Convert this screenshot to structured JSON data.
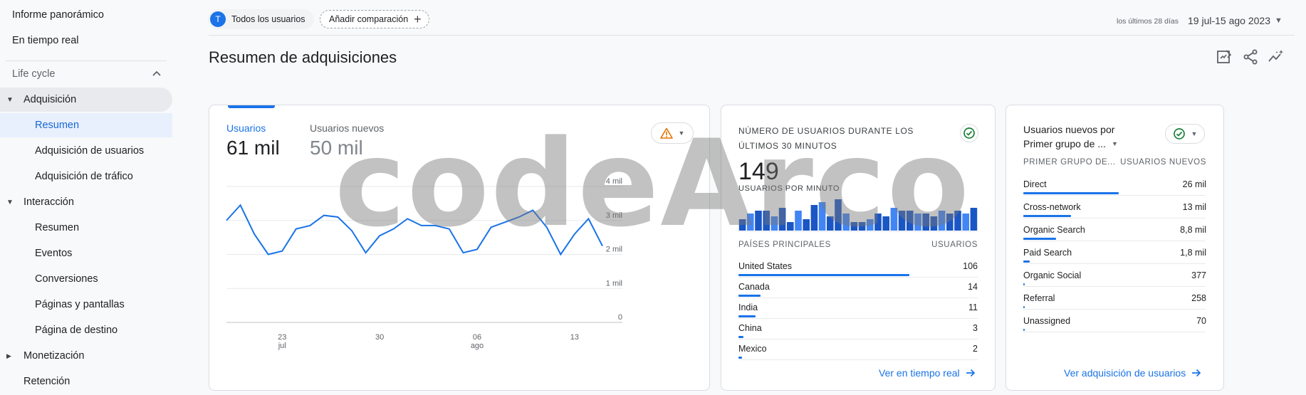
{
  "sidebar": {
    "top_items": [
      {
        "label": "Informe panorámico"
      },
      {
        "label": "En tiempo real"
      }
    ],
    "section": {
      "label": "Life cycle"
    },
    "groups": {
      "adquisicion": {
        "label": "Adquisición",
        "items": [
          "Resumen",
          "Adquisición de usuarios",
          "Adquisición de tráfico"
        ]
      },
      "interaccion": {
        "label": "Interacción",
        "items": [
          "Resumen",
          "Eventos",
          "Conversiones",
          "Páginas y pantallas",
          "Página de destino"
        ]
      },
      "monetizacion": {
        "label": "Monetización"
      },
      "retencion": {
        "label": "Retención"
      }
    }
  },
  "topbar": {
    "avatar_letter": "T",
    "segment_label": "Todos los usuarios",
    "add_comparison": "Añadir comparación",
    "date_hint": "los últimos 28 días",
    "date_range": "19 jul-15 ago 2023"
  },
  "page": {
    "title": "Resumen de adquisiciones"
  },
  "users_card": {
    "metric1_label": "Usuarios",
    "metric1_value": "61 mil",
    "metric2_label": "Usuarios nuevos",
    "metric2_value": "50 mil"
  },
  "chart_data": {
    "type": "line",
    "x": [
      "19 jul",
      "20 jul",
      "21 jul",
      "22 jul",
      "23 jul",
      "24 jul",
      "25 jul",
      "26 jul",
      "27 jul",
      "28 jul",
      "29 jul",
      "30 jul",
      "31 jul",
      "01 ago",
      "02 ago",
      "03 ago",
      "04 ago",
      "05 ago",
      "06 ago",
      "07 ago",
      "08 ago",
      "09 ago",
      "10 ago",
      "11 ago",
      "12 ago",
      "13 ago",
      "14 ago",
      "15 ago"
    ],
    "series": [
      {
        "values": [
          3.0,
          3.45,
          2.6,
          2.0,
          2.1,
          2.75,
          2.85,
          3.15,
          3.1,
          2.7,
          2.05,
          2.55,
          2.75,
          3.05,
          2.85,
          2.85,
          2.75,
          2.05,
          2.15,
          2.8,
          2.95,
          3.1,
          3.3,
          2.8,
          2.0,
          2.6,
          3.05,
          2.25
        ]
      }
    ],
    "x_ticks": [
      {
        "at": "23 jul",
        "day": "23",
        "month": "jul"
      },
      {
        "at": "30 jul",
        "day": "30",
        "month": ""
      },
      {
        "at": "06 ago",
        "day": "06",
        "month": "ago"
      },
      {
        "at": "13 ago",
        "day": "13",
        "month": ""
      }
    ],
    "y_ticks": [
      {
        "value": 4,
        "label": "4 mil"
      },
      {
        "value": 3,
        "label": "3 mil"
      },
      {
        "value": 2,
        "label": "2 mil"
      },
      {
        "value": 1,
        "label": "1 mil"
      },
      {
        "value": 0,
        "label": "0"
      }
    ],
    "ylim": [
      0,
      4
    ],
    "grid": true,
    "line_color": "#1a73e8"
  },
  "realtime_card": {
    "title": "NÚMERO DE USUARIOS DURANTE LOS ÚLTIMOS 30 MINUTOS",
    "value": "149",
    "subtitle": "USUARIOS POR MINUTO",
    "minute_bars": [
      4,
      6,
      7,
      7,
      5,
      8,
      3,
      7,
      4,
      9,
      10,
      5,
      11,
      6,
      3,
      3,
      4,
      6,
      5,
      8,
      7,
      7,
      6,
      6,
      5,
      7,
      6,
      7,
      6,
      8
    ],
    "col_country": "PAÍSES PRINCIPALES",
    "col_users": "USUARIOS",
    "rows": [
      {
        "name": "United States",
        "value": "106",
        "share": 1.0
      },
      {
        "name": "Canada",
        "value": "14",
        "share": 0.13
      },
      {
        "name": "India",
        "value": "11",
        "share": 0.1
      },
      {
        "name": "China",
        "value": "3",
        "share": 0.03
      },
      {
        "name": "Mexico",
        "value": "2",
        "share": 0.02
      }
    ],
    "link": "Ver en tiempo real"
  },
  "newusers_card": {
    "title": "Usuarios nuevos por",
    "dimension": "Primer grupo de ...",
    "col_group": "PRIMER GRUPO DE...",
    "col_users": "USUARIOS NUEVOS",
    "rows": [
      {
        "name": "Direct",
        "value": "26 mil",
        "share": 1.0
      },
      {
        "name": "Cross-network",
        "value": "13 mil",
        "share": 0.5
      },
      {
        "name": "Organic Search",
        "value": "8,8 mil",
        "share": 0.34
      },
      {
        "name": "Paid Search",
        "value": "1,8 mil",
        "share": 0.07
      },
      {
        "name": "Organic Social",
        "value": "377",
        "share": 0.015
      },
      {
        "name": "Referral",
        "value": "258",
        "share": 0.01
      },
      {
        "name": "Unassigned",
        "value": "70",
        "share": 0.003
      }
    ],
    "link": "Ver adquisición de usuarios"
  },
  "watermark": "codeArco",
  "colors": {
    "accent": "#1a73e8",
    "warning": "#e37400",
    "success": "#188038"
  }
}
